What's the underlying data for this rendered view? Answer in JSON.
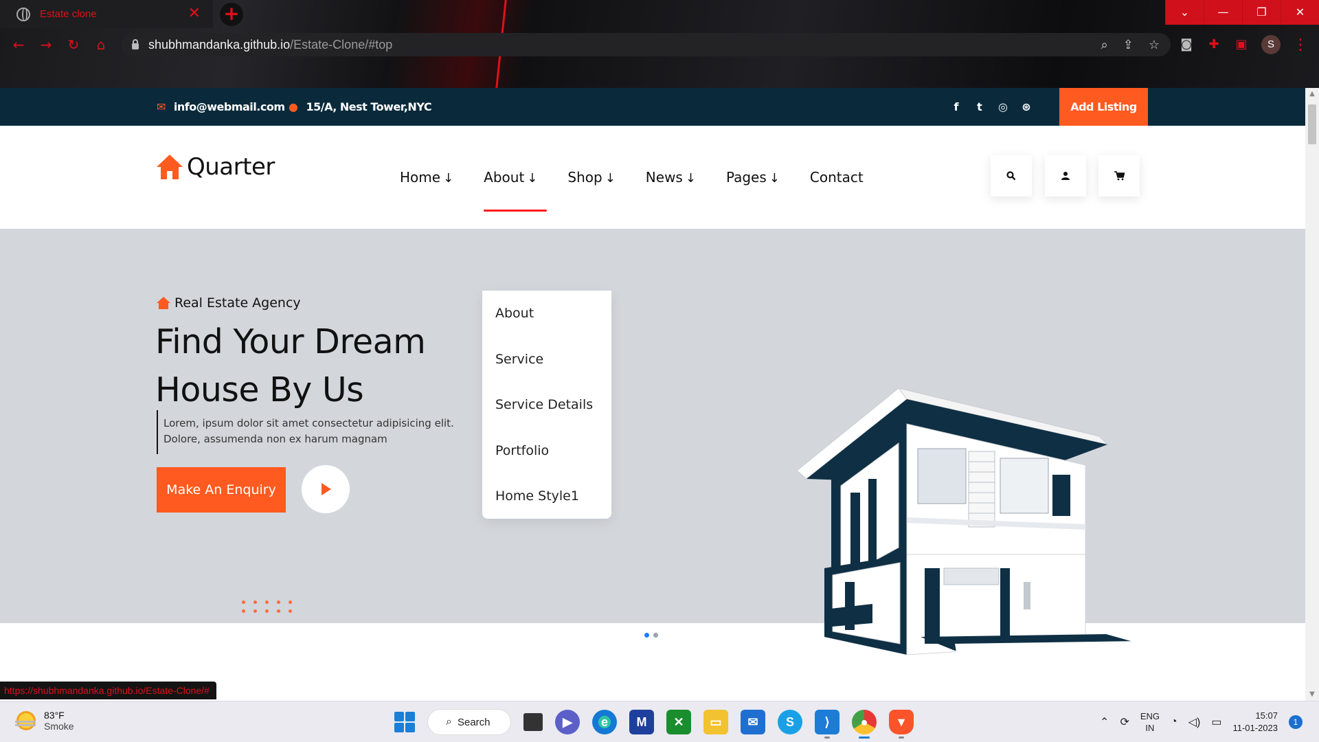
{
  "browser": {
    "tab_title": "Estate clone",
    "url_host": "shubhmandanka.github.io",
    "url_path": "/Estate-Clone/#top",
    "profile_initial": "S",
    "status_url": "https://shubhmandanka.github.io/Estate-Clone/#",
    "accent_color": "#e0101a"
  },
  "topbar": {
    "email": "info@webmail.com",
    "address": "15/A, Nest Tower,NYC",
    "socials": [
      "facebook-icon",
      "twitter-icon",
      "instagram-icon",
      "dribbble-icon"
    ],
    "cta_label": "Add Listing",
    "bg_color": "#0a2a3c"
  },
  "navbar": {
    "logo_text": "Quarter",
    "menu": [
      {
        "label": "Home",
        "has_dropdown": true
      },
      {
        "label": "About",
        "has_dropdown": true,
        "active": true
      },
      {
        "label": "Shop",
        "has_dropdown": true
      },
      {
        "label": "News",
        "has_dropdown": true
      },
      {
        "label": "Pages",
        "has_dropdown": true
      },
      {
        "label": "Contact",
        "has_dropdown": false
      }
    ],
    "arrow_glyph": "↓",
    "icons": [
      "search-icon",
      "user-icon",
      "cart-icon"
    ]
  },
  "dropdown": {
    "items": [
      "About",
      "Service",
      "Service Details",
      "Portfolio",
      "Home Style1"
    ]
  },
  "hero": {
    "tagline": "Real Estate Agency",
    "headline_line1": "Find Your Dream",
    "headline_line2": "House By Us",
    "desc_line1": "Lorem, ipsum dolor sit amet consectetur adipisicing elit.",
    "desc_line2": "Dolore, assumenda non ex harum magnam",
    "cta_label": "Make An Enquiry",
    "slides_total": 2,
    "slide_active": 1,
    "accent_color": "#ff5a1f"
  },
  "taskbar": {
    "weather_temp": "83°F",
    "weather_cond": "Smoke",
    "search_label": "Search",
    "apps": [
      "task-view-icon",
      "teams-icon",
      "edge-icon",
      "app-icon",
      "xbox-icon",
      "file-explorer-icon",
      "mail-icon",
      "skype-icon",
      "vscode-icon",
      "chrome-icon",
      "brave-icon"
    ],
    "lang_line1": "ENG",
    "lang_line2": "IN",
    "time": "15:07",
    "date": "11-01-2023",
    "notifications": "1"
  }
}
